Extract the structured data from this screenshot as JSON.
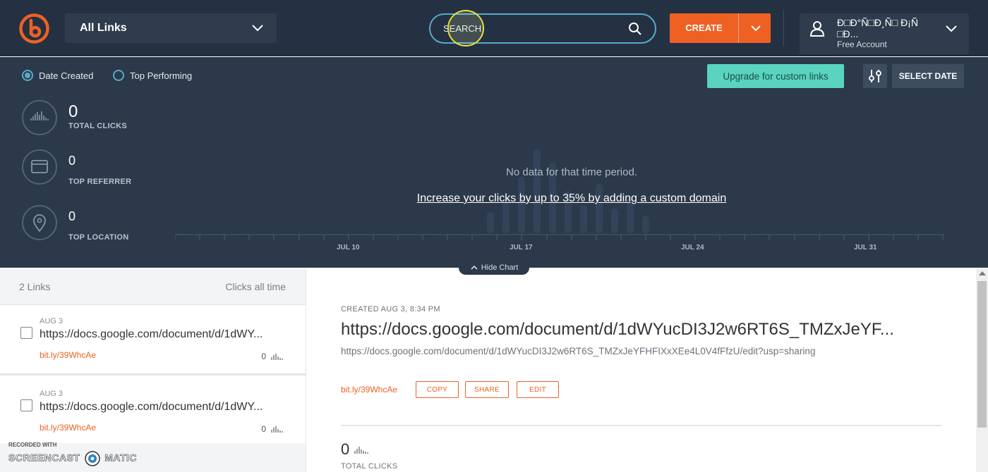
{
  "header": {
    "links_dropdown": "All Links",
    "search_placeholder": "SEARCH",
    "create_label": "CREATE",
    "account_name": "Ð□Ð°Ñ□Ð¸Ñ□ Ð¡Ñ□Ð...",
    "account_plan": "Free Account"
  },
  "filters": {
    "date_created": "Date Created",
    "top_performing": "Top Performing",
    "selected": "Date Created"
  },
  "actions": {
    "upgrade": "Upgrade for custom links",
    "select_date": "SELECT DATE"
  },
  "stats": {
    "total_clicks_value": "0",
    "total_clicks_label": "TOTAL CLICKS",
    "top_referrer_value": "0",
    "top_referrer_label": "TOP REFERRER",
    "top_location_value": "0",
    "top_location_label": "TOP LOCATION"
  },
  "chart": {
    "no_data": "No data for that time period.",
    "promo_link": "Increase your clicks by up to 35% by adding a custom domain",
    "ticks": [
      "JUL 10",
      "JUL 17",
      "JUL 24",
      "JUL 31"
    ],
    "hide_chart": "Hide Chart"
  },
  "list": {
    "count_label": "2 Links",
    "sort_label": "Clicks all time",
    "items": [
      {
        "date": "AUG 3",
        "url": "https://docs.google.com/document/d/1dWY...",
        "short": "bit.ly/39WhcAe",
        "clicks": "0"
      },
      {
        "date": "AUG 3",
        "url": "https://docs.google.com/document/d/1dWY...",
        "short": "bit.ly/39WhcAe",
        "clicks": "0"
      }
    ]
  },
  "detail": {
    "created": "CREATED AUG 3, 8:34 PM",
    "title": "https://docs.google.com/document/d/1dWYucDI3J2w6RT6S_TMZxJeYF...",
    "long_url": "https://docs.google.com/document/d/1dWYucDI3J2w6RT6S_TMZxJeYFHFIXxXEe4L0V4fFfzU/edit?usp=sharing",
    "short": "bit.ly/39WhcAe",
    "copy": "COPY",
    "share": "SHARE",
    "edit": "EDIT",
    "total_clicks_value": "0",
    "total_clicks_label": "TOTAL CLICKS"
  },
  "watermark": {
    "recorded_with": "RECORDED WITH",
    "brand_left": "SCREENCAST",
    "brand_right": "MATIC"
  },
  "colors": {
    "header_bg": "#233142",
    "panel_bg": "#2b394a",
    "accent_orange": "#ee6123",
    "accent_teal": "#5ad3c0",
    "link_blue": "#5aa9c9"
  },
  "icons": [
    "bitly-logo-icon",
    "chevron-down-icon",
    "search-icon",
    "user-icon",
    "filter-sliders-icon",
    "bar-chart-icon",
    "browser-window-icon",
    "location-pin-icon",
    "chevron-up-icon"
  ]
}
